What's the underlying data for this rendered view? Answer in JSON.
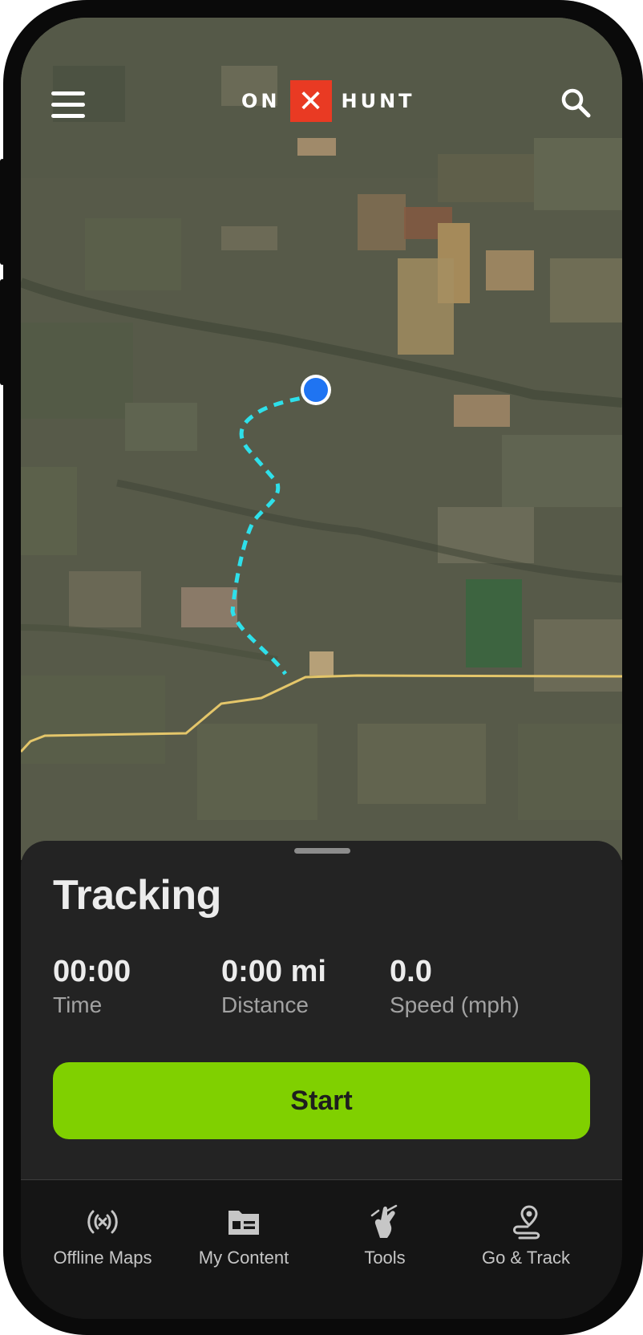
{
  "app": {
    "logo_left": "ON",
    "logo_mark": "✕",
    "logo_right": "HUNT",
    "accent_color": "#e93a23",
    "start_color": "#80d000",
    "track_color": "#2ee0ea",
    "road_color": "#e4c66a",
    "location_color": "#1f74f2"
  },
  "header": {
    "menu_icon": "hamburger-menu-icon",
    "search_icon": "search-icon"
  },
  "tracking": {
    "title": "Tracking",
    "stats": [
      {
        "value": "00:00",
        "label": "Time"
      },
      {
        "value": "0:00 mi",
        "label": "Distance"
      },
      {
        "value": "0.0",
        "label": "Speed (mph)"
      }
    ],
    "start_label": "Start"
  },
  "tabs": [
    {
      "label": "Offline Maps",
      "icon": "offline-signal-icon"
    },
    {
      "label": "My Content",
      "icon": "folder-icon"
    },
    {
      "label": "Tools",
      "icon": "tools-icon"
    },
    {
      "label": "Go & Track",
      "icon": "go-track-icon"
    }
  ]
}
